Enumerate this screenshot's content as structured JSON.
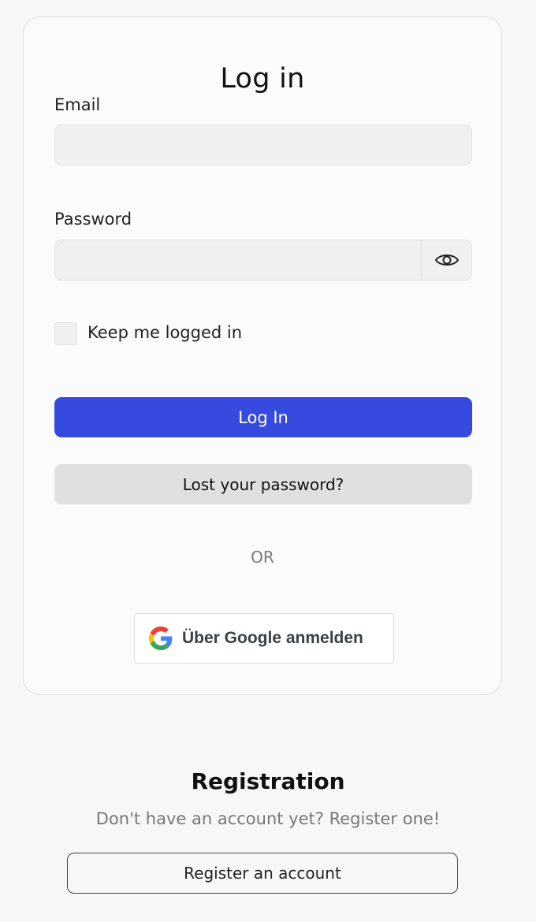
{
  "login": {
    "title": "Log in",
    "email_label": "Email",
    "email_value": "",
    "email_placeholder": "",
    "password_label": "Password",
    "password_value": "",
    "password_placeholder": "",
    "password_toggle_icon": "eye-icon",
    "keep_logged_in_label": "Keep me logged in",
    "keep_logged_in_checked": false,
    "login_button": "Log In",
    "lost_password_button": "Lost your password?",
    "or_text": "OR",
    "google_button": "Über Google anmelden",
    "google_icon": "google-g-icon"
  },
  "registration": {
    "title": "Registration",
    "text": "Don't have an account yet? Register one!",
    "button": "Register an account"
  },
  "colors": {
    "primary": "#364ae0",
    "secondary_button": "#e0e0e0",
    "page_bg": "#f7f7f7",
    "card_bg": "#fbfbfb"
  }
}
